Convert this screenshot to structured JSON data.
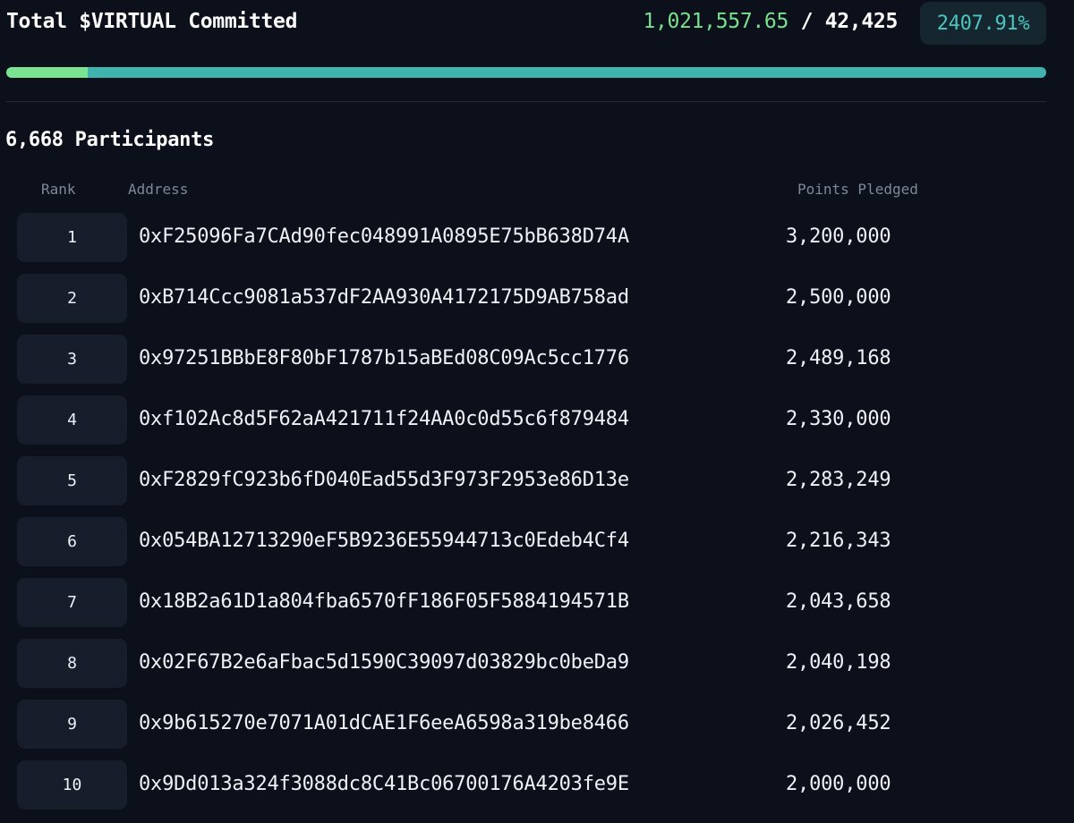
{
  "header": {
    "title": "Total $VIRTUAL Committed",
    "committed": "1,021,557.65",
    "separator": "/",
    "target": "42,425",
    "percent": "2407.91%"
  },
  "progress": {
    "fill_fraction": 0.078,
    "fill_color": "#7be493",
    "track_color": "#3fb4ae"
  },
  "participants": {
    "title": "6,668 Participants"
  },
  "table": {
    "columns": {
      "rank": "Rank",
      "address": "Address",
      "points": "Points Pledged"
    },
    "rows": [
      {
        "rank": "1",
        "address": "0xF25096Fa7CAd90fec048991A0895E75bB638D74A",
        "points": "3,200,000"
      },
      {
        "rank": "2",
        "address": "0xB714Ccc9081a537dF2AA930A4172175D9AB758ad",
        "points": "2,500,000"
      },
      {
        "rank": "3",
        "address": "0x97251BBbE8F80bF1787b15aBEd08C09Ac5cc1776",
        "points": "2,489,168"
      },
      {
        "rank": "4",
        "address": "0xf102Ac8d5F62aA421711f24AA0c0d55c6f879484",
        "points": "2,330,000"
      },
      {
        "rank": "5",
        "address": "0xF2829fC923b6fD040Ead55d3F973F2953e86D13e",
        "points": "2,283,249"
      },
      {
        "rank": "6",
        "address": "0x054BA12713290eF5B9236E55944713c0Edeb4Cf4",
        "points": "2,216,343"
      },
      {
        "rank": "7",
        "address": "0x18B2a61D1a804fba6570fF186F05F5884194571B",
        "points": "2,043,658"
      },
      {
        "rank": "8",
        "address": "0x02F67B2e6aFbac5d1590C39097d03829bc0beDa9",
        "points": "2,040,198"
      },
      {
        "rank": "9",
        "address": "0x9b615270e7071A01dCAE1F6eeA6598a319be8466",
        "points": "2,026,452"
      },
      {
        "rank": "10",
        "address": "0x9Dd013a324f3088dc8C41Bc06700176A4203fe9E",
        "points": "2,000,000"
      }
    ]
  }
}
